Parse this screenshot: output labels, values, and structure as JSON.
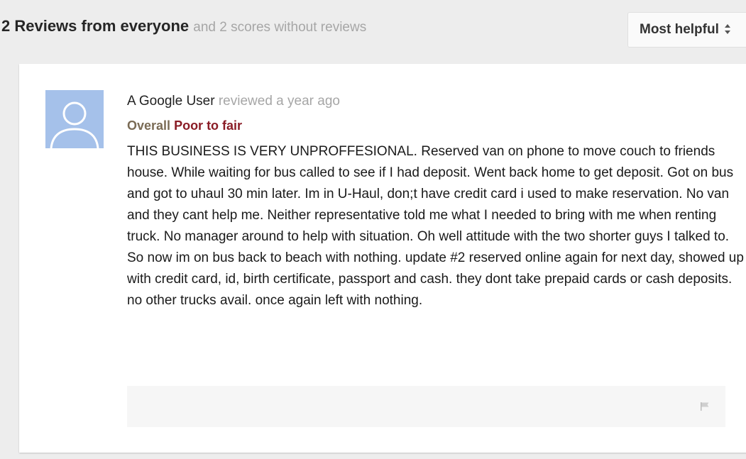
{
  "header": {
    "count_title": "2 Reviews from everyone",
    "subtitle": "and 2 scores without reviews",
    "sort": {
      "label": "Most helpful",
      "icon": "sort-arrows-icon"
    }
  },
  "review": {
    "author": "A Google User",
    "posted": "reviewed a year ago",
    "rating_label": "Overall",
    "rating_value": "Poor to fair",
    "text": "THIS BUSINESS IS VERY UNPROFFESIONAL. Reserved van on phone to move couch to friends house. While waiting for bus called to see if I had deposit. Went back home to get deposit. Got on bus and got to uhaul 30 min later. Im in U-Haul, don;t have credit card i used to make reservation. No van and they cant help me. Neither representative told me what I needed to bring with me when renting truck. No manager around to help with situation. Oh well attitude with the two shorter guys I talked to. So now im on bus back to beach with nothing. update #2 reserved online again for next day, showed up with credit card, id, birth certificate, passport and cash. they dont take prepaid cards or cash deposits. no other trucks avail. once again left with nothing.",
    "avatar_icon": "default-user-avatar-icon",
    "flag_icon": "flag-icon"
  },
  "colors": {
    "page_background": "#ededed",
    "card_background": "#ffffff",
    "rating_value": "#8a1c26",
    "muted_text": "#a6a6a6",
    "avatar_background": "#a5c1ea"
  }
}
